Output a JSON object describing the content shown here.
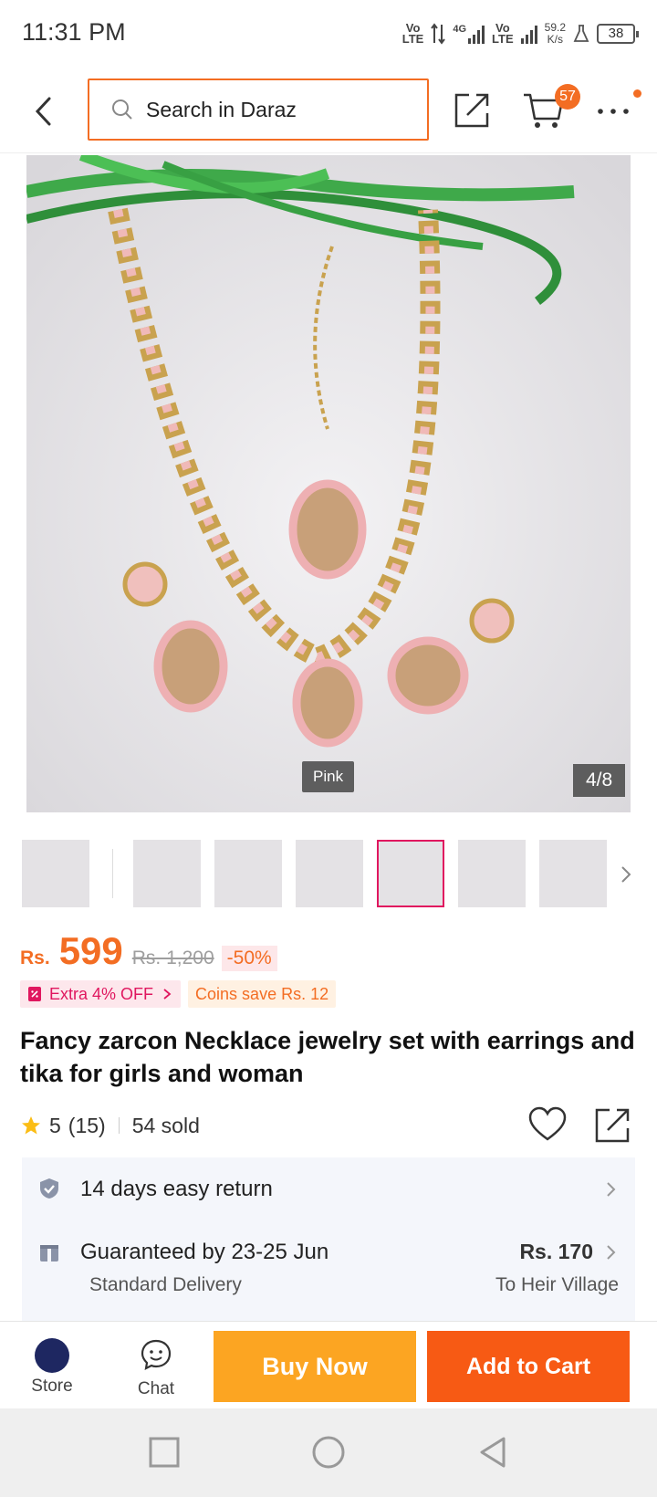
{
  "status_bar": {
    "time": "11:31 PM",
    "volte1_top": "Vo",
    "volte1_bottom": "LTE",
    "network": "4G",
    "volte2_top": "Vo",
    "volte2_bottom": "LTE",
    "speed_value": "59.2",
    "speed_unit": "K/s",
    "battery": "38"
  },
  "header": {
    "search_placeholder": "Search in Daraz",
    "cart_count": "57",
    "accent_color": "#f36d23"
  },
  "gallery": {
    "variant_label": "Pink",
    "image_counter": "4/8",
    "thumbnail_count": 7,
    "active_thumbnail_index": 4
  },
  "price": {
    "currency": "Rs.",
    "current": "599",
    "original": "Rs. 1,200",
    "discount": "-50%"
  },
  "promos": {
    "extra_off": "Extra 4% OFF",
    "coins": "Coins save Rs. 12"
  },
  "product": {
    "title": "Fancy zarcon Necklace jewelry set with earrings and tika for girls and woman",
    "rating": "5",
    "rating_count": "(15)",
    "sold": "54 sold"
  },
  "services": {
    "return_policy": "14 days easy return",
    "delivery_guarantee": "Guaranteed by 23-25 Jun",
    "delivery_type": "Standard Delivery",
    "delivery_fee": "Rs. 170",
    "delivery_location": "To Heir Village"
  },
  "bottom_bar": {
    "store_label": "Store",
    "chat_label": "Chat",
    "buy_now": "Buy Now",
    "add_to_cart": "Add to Cart"
  }
}
